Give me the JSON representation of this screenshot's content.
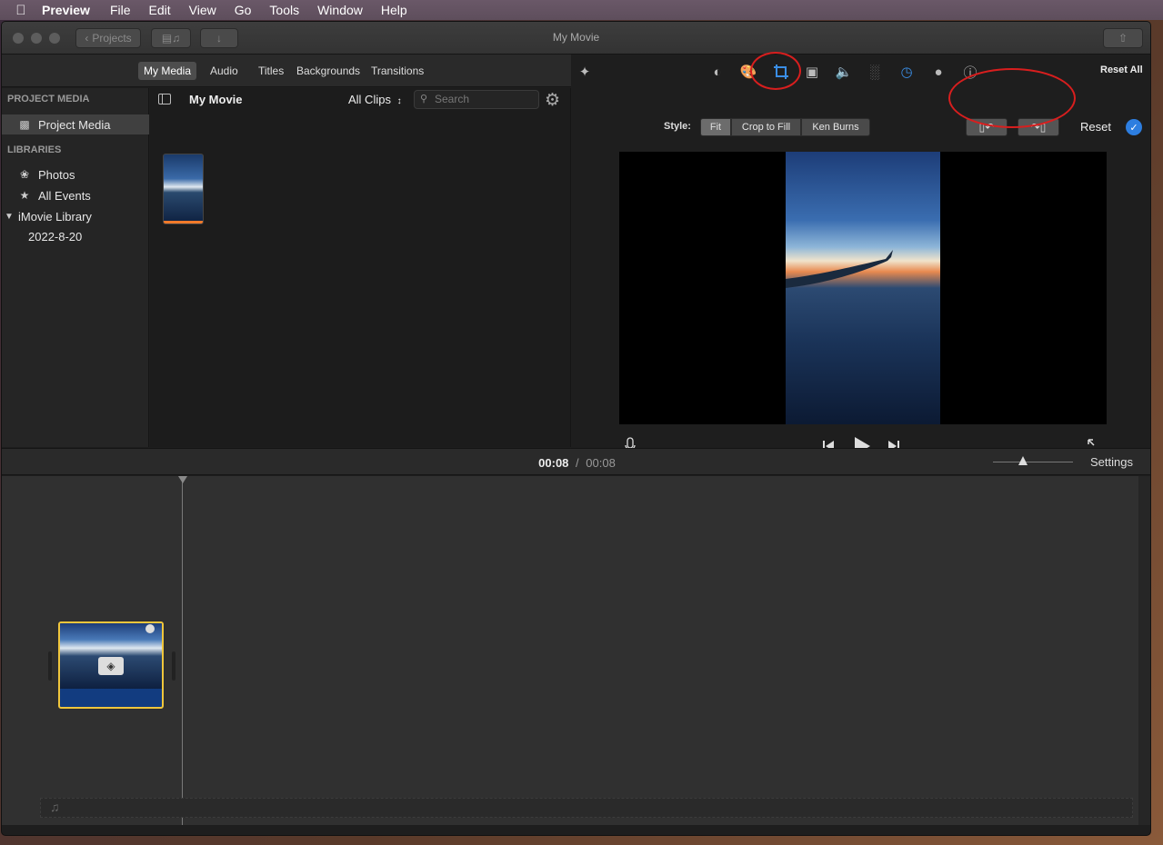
{
  "menubar": {
    "app": "Preview",
    "items": [
      "File",
      "Edit",
      "View",
      "Go",
      "Tools",
      "Window",
      "Help"
    ]
  },
  "window": {
    "title": "My Movie",
    "projects_button": "Projects"
  },
  "media_tabs": [
    "My Media",
    "Audio",
    "Titles",
    "Backgrounds",
    "Transitions"
  ],
  "sidebar": {
    "project_media_header": "PROJECT MEDIA",
    "project_media_item": "Project Media",
    "libraries_header": "LIBRARIES",
    "library_items": [
      "Photos",
      "All Events",
      "iMovie Library"
    ],
    "event": "2022-8-20"
  },
  "browser": {
    "title": "My Movie",
    "filter": "All Clips",
    "search_placeholder": "Search"
  },
  "viewer": {
    "reset_all": "Reset All",
    "style_label": "Style:",
    "styles": [
      "Fit",
      "Crop to Fill",
      "Ken Burns"
    ],
    "selected_style": "Fit",
    "reset": "Reset"
  },
  "timeline": {
    "current_time": "00:08",
    "separator": "/",
    "total_time": "00:08",
    "settings": "Settings"
  },
  "colors": {
    "accent": "#2d7ee0",
    "clip_border": "#f0c63c",
    "annotation": "#d81e1e"
  }
}
